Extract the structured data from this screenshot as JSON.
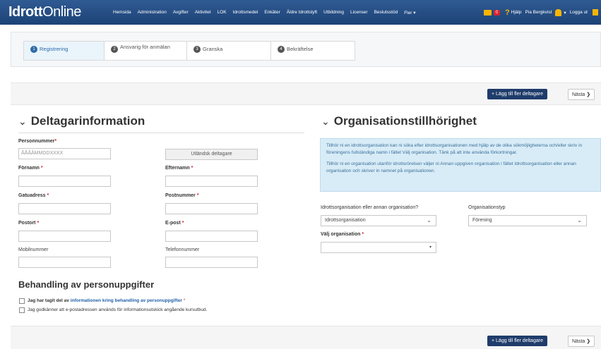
{
  "app": {
    "logo_part1": "Idrott",
    "logo_part2": "Online"
  },
  "nav": {
    "items": [
      "Hemsida",
      "Administration",
      "Avgifter",
      "Aktivitet",
      "LOK",
      "Idrottsmedel",
      "Enkäter",
      "Äldre Idrottslyft",
      "Utbildning",
      "Licenser",
      "Beslutsstöd",
      "Fler ▾"
    ],
    "cart_count": "0",
    "help": "Hjälp",
    "user": "Pia Bergkvist",
    "logout": "Logga ut"
  },
  "steps": [
    {
      "num": "1",
      "label": "Registrering"
    },
    {
      "num": "2",
      "label": "Ansvarig för anmälan"
    },
    {
      "num": "3",
      "label": "Granska"
    },
    {
      "num": "4",
      "label": "Bekräftelse"
    }
  ],
  "actions": {
    "add_more": "+ Lägg till fler deltagare",
    "next": "Nästa ❯"
  },
  "participant": {
    "title": "Deltagarinformation",
    "personnummer_label": "Personnummer",
    "personnummer_placeholder": "ÅÅÅÅMMDDXXXX",
    "foreign_button": "Utländsk deltagare",
    "fornamn": "Förnamn",
    "efternamn": "Efternamn",
    "gatuadress": "Gatuadress",
    "postnummer": "Postnummer",
    "postort": "Postort",
    "epost": "E-post",
    "mobil": "Mobilnummer",
    "telefon": "Telefonnummer"
  },
  "gdpr": {
    "title": "Behandling av personuppgifter",
    "check1_pre": "Jag har tagit del av",
    "check1_link": "informationen kring behandling av personuppgifter",
    "check2": "Jag godkänner att e-postadressen används för informationsutskick angående kursutbud."
  },
  "org": {
    "title": "Organisationstillhörighet",
    "info1": "Tillhör ni en idrottsorganisation kan ni söka efter idrottsorganisationen med hjälp av de olika sökmöjligheterna och/eller skriv in föreningens fullständiga namn i fältet Välj organisation. Tänk på att inte använda förkortningar.",
    "info2": "Tillhör ni en organisation utanför idrottsrörelsen väljer ni Annan uppgiven organisation i fältet Idrottsorganisation eller annan organisation och skriver in namnet på organisationen.",
    "org_kind_label": "Idrottsorganisation eller annan organisation?",
    "org_kind_value": "Idrottsorganisation",
    "org_type_label": "Organisationstyp",
    "org_type_value": "Förening",
    "choose_org_label": "Välj organisation",
    "choose_org_value": ""
  },
  "colors": {
    "nav": "#1d4376",
    "primary": "#1f3c6b",
    "required": "#d9232e",
    "info_bg": "#d8ecf7",
    "link": "#1f5fa8"
  }
}
